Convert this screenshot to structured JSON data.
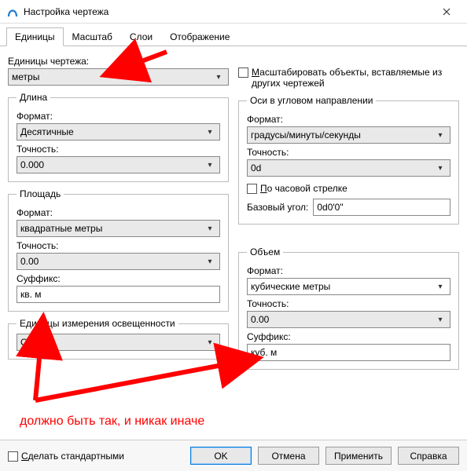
{
  "window": {
    "title": "Настройка чертежа"
  },
  "tabs": {
    "units": "Единицы",
    "scale": "Масштаб",
    "layers": "Слои",
    "display": "Отображение"
  },
  "units_label": "Единицы чертежа:",
  "units_value": "метры",
  "scale_objects": "Масштабировать объекты, вставляемые из других чертежей",
  "length": {
    "legend": "Длина",
    "format_label": "Формат:",
    "format_value": "Десятичные",
    "precision_label": "Точность:",
    "precision_value": "0.000"
  },
  "angle": {
    "legend": "Оси в угловом направлении",
    "format_label": "Формат:",
    "format_value": "градусы/минуты/секунды",
    "precision_label": "Точность:",
    "precision_value": "0d",
    "clockwise": "По часовой стрелке",
    "base_label": "Базовый угол:",
    "base_value": "0d0'0\""
  },
  "area": {
    "legend": "Площадь",
    "format_label": "Формат:",
    "format_value": "квадратные метры",
    "precision_label": "Точность:",
    "precision_value": "0.00",
    "suffix_label": "Суффикс:",
    "suffix_value": "кв. м"
  },
  "volume": {
    "legend": "Объем",
    "format_label": "Формат:",
    "format_value": "кубические метры",
    "precision_label": "Точность:",
    "precision_value": "0.00",
    "suffix_label": "Суффикс:",
    "suffix_value": "куб. м"
  },
  "lighting": {
    "legend": "Единицы измерения освещенности",
    "value": "Общие"
  },
  "make_default": "Сделать стандартными",
  "buttons": {
    "ok": "OK",
    "cancel": "Отмена",
    "apply": "Применить",
    "help": "Справка"
  },
  "annotation": "должно быть так, и никак иначе"
}
